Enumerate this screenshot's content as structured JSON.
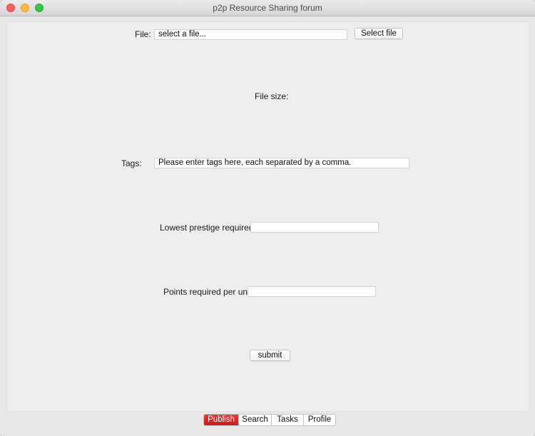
{
  "window": {
    "title": "p2p Resource Sharing forum"
  },
  "form": {
    "file_label": "File:",
    "file_value": "select a file...",
    "select_file_button": "Select file",
    "file_size_label": "File size:",
    "tags_label": "Tags:",
    "tags_value": "Please enter tags here, each separated by a comma.",
    "prestige_label": "Lowest prestige required:",
    "prestige_value": "",
    "points_label": "Points required per unit:",
    "points_value": "",
    "submit_button": "submit"
  },
  "tabs": [
    {
      "label": "Publish",
      "active": true
    },
    {
      "label": "Search",
      "active": false
    },
    {
      "label": "Tasks",
      "active": false
    },
    {
      "label": "Profile",
      "active": false
    }
  ],
  "colors": {
    "active_tab": "#d42a2a",
    "window_bg": "#e8e8e8",
    "panel_bg": "#eeeeee"
  }
}
